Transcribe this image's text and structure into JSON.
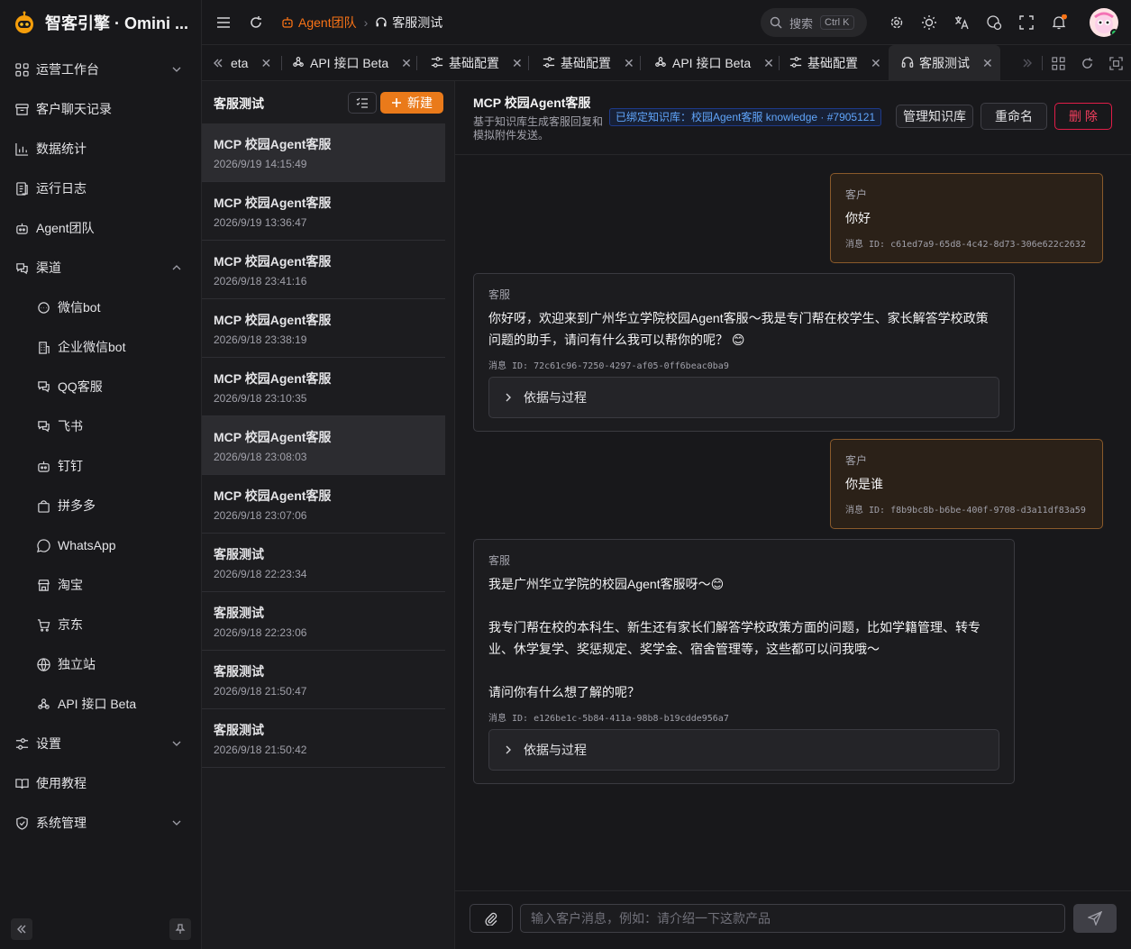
{
  "app": {
    "name": "智客引擎 · Omini ..."
  },
  "sidebar": {
    "items": [
      {
        "label": "运营工作台",
        "icon": "grid-icon",
        "chevron": "down"
      },
      {
        "label": "客户聊天记录",
        "icon": "archive-icon"
      },
      {
        "label": "数据统计",
        "icon": "bar-chart-icon"
      },
      {
        "label": "运行日志",
        "icon": "log-icon"
      },
      {
        "label": "Agent团队",
        "icon": "bot-icon"
      },
      {
        "label": "渠道",
        "icon": "channels-icon",
        "chevron": "up"
      },
      {
        "label": "微信bot",
        "icon": "chat-bubble-icon",
        "sub": true
      },
      {
        "label": "企业微信bot",
        "icon": "building-icon",
        "sub": true
      },
      {
        "label": "QQ客服",
        "icon": "chat-icon",
        "sub": true
      },
      {
        "label": "飞书",
        "icon": "chat-icon",
        "sub": true
      },
      {
        "label": "钉钉",
        "icon": "bot-icon",
        "sub": true
      },
      {
        "label": "拼多多",
        "icon": "shopping-bag-icon",
        "sub": true
      },
      {
        "label": "WhatsApp",
        "icon": "whatsapp-icon",
        "sub": true
      },
      {
        "label": "淘宝",
        "icon": "store-icon",
        "sub": true
      },
      {
        "label": "京东",
        "icon": "cart-icon",
        "sub": true
      },
      {
        "label": "独立站",
        "icon": "globe-icon",
        "sub": true
      },
      {
        "label": "API 接口 Beta",
        "icon": "webhook-icon",
        "sub": true
      },
      {
        "label": "设置",
        "icon": "settings-icon",
        "chevron": "down"
      },
      {
        "label": "使用教程",
        "icon": "book-icon"
      },
      {
        "label": "系统管理",
        "icon": "shield-icon",
        "chevron": "down"
      }
    ]
  },
  "topbar": {
    "breadcrumb": {
      "parent": "Agent团队",
      "current": "客服测试"
    },
    "search": {
      "label": "搜索",
      "shortcut": "Ctrl K"
    }
  },
  "tabs": [
    {
      "label": "eta"
    },
    {
      "label": "API 接口 Beta"
    },
    {
      "label": "基础配置"
    },
    {
      "label": "基础配置"
    },
    {
      "label": "API 接口 Beta"
    },
    {
      "label": "基础配置"
    },
    {
      "label": "客服测试",
      "active": true
    }
  ],
  "conversations": {
    "title": "客服测试",
    "new_label": "新建",
    "items": [
      {
        "title": "MCP 校园Agent客服",
        "time": "2026/9/19 14:15:49",
        "active": true
      },
      {
        "title": "MCP 校园Agent客服",
        "time": "2026/9/19 13:36:47"
      },
      {
        "title": "MCP 校园Agent客服",
        "time": "2026/9/18 23:41:16"
      },
      {
        "title": "MCP 校园Agent客服",
        "time": "2026/9/18 23:38:19"
      },
      {
        "title": "MCP 校园Agent客服",
        "time": "2026/9/18 23:10:35"
      },
      {
        "title": "MCP 校园Agent客服",
        "time": "2026/9/18 23:08:03",
        "active": true
      },
      {
        "title": "MCP 校园Agent客服",
        "time": "2026/9/18 23:07:06"
      },
      {
        "title": "客服测试",
        "time": "2026/9/18 22:23:34"
      },
      {
        "title": "客服测试",
        "time": "2026/9/18 22:23:06"
      },
      {
        "title": "客服测试",
        "time": "2026/9/18 21:50:47"
      },
      {
        "title": "客服测试",
        "time": "2026/9/18 21:50:42"
      }
    ]
  },
  "chat": {
    "title": "MCP 校园Agent客服",
    "description": "基于知识库生成客服回复和模拟附件发送。",
    "kb_tag": "已绑定知识库：校园Agent客服 knowledge · #7905121",
    "buttons": {
      "manage_kb": "管理知识库",
      "rename": "重命名",
      "delete": "删 除"
    },
    "messages": [
      {
        "role": "客户",
        "text": "你好",
        "id_label": "消息 ID: c61ed7a9-65d8-4c42-8d73-306e622c2632"
      },
      {
        "role": "客服",
        "text": "你好呀，欢迎来到广州华立学院校园Agent客服～我是专门帮在校学生、家长解答学校政策问题的助手，请问有什么我可以帮你的呢？ 😊",
        "id_label": "消息 ID: 72c61c96-7250-4297-af05-0ff6beac0ba9",
        "process": "依据与过程"
      },
      {
        "role": "客户",
        "text": "你是谁",
        "id_label": "消息 ID: f8b9bc8b-b6be-400f-9708-d3a11df83a59"
      },
      {
        "role": "客服",
        "text": "我是广州华立学院的校园Agent客服呀～😊\n\n我专门帮在校的本科生、新生还有家长们解答学校政策方面的问题，比如学籍管理、转专业、休学复学、奖惩规定、奖学金、宿舍管理等，这些都可以问我哦～\n\n请问你有什么想了解的呢？",
        "id_label": "消息 ID: e126be1c-5b84-411a-98b8-b19cdde956a7",
        "process": "依据与过程"
      }
    ],
    "composer": {
      "placeholder": "输入客户消息，例如：请介绍一下这款产品"
    }
  },
  "colors": {
    "accent": "#ea7a1a",
    "danger": "#f43f5e",
    "link": "#60a5fa",
    "online": "#22c55e"
  }
}
